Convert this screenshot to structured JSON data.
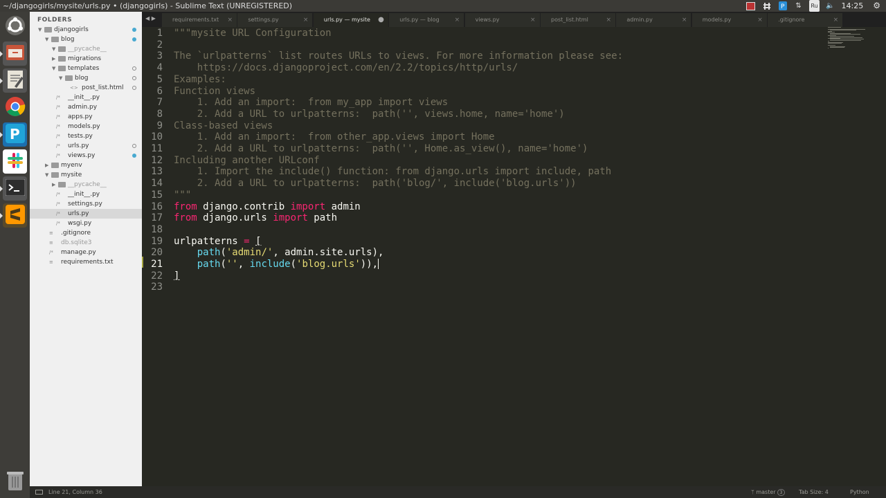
{
  "window": {
    "title": "~/djangogirls/mysite/urls.py • (djangogirls) - Sublime Text (UNREGISTERED)",
    "clock": "14:25",
    "keyboard_layout": "Ru"
  },
  "launcher": {
    "items": [
      {
        "name": "ubuntu-dash-icon",
        "color": "#e06b2b"
      },
      {
        "name": "files-icon",
        "color": "#c8553a"
      },
      {
        "name": "text-editor-icon",
        "color": "#d9d4c5"
      },
      {
        "name": "chrome-icon",
        "color": "#4285f4"
      },
      {
        "name": "pycharm-icon",
        "color": "#21a4d8"
      },
      {
        "name": "slack-icon",
        "color": "#ffffff"
      },
      {
        "name": "terminal-icon",
        "color": "#2d2d2d"
      },
      {
        "name": "sublime-text-icon",
        "color": "#ff9800"
      },
      {
        "name": "trash-icon",
        "color": "#8a8a8a"
      }
    ]
  },
  "sidebar": {
    "header": "FOLDERS",
    "items": [
      {
        "label": "djangogirls",
        "type": "folder",
        "depth": 0,
        "open": true,
        "dim": false,
        "status": "filled"
      },
      {
        "label": "blog",
        "type": "folder",
        "depth": 1,
        "open": true,
        "dim": false,
        "status": "filled"
      },
      {
        "label": "__pycache__",
        "type": "folder",
        "depth": 2,
        "open": true,
        "dim": true,
        "status": ""
      },
      {
        "label": "migrations",
        "type": "folder",
        "depth": 2,
        "open": false,
        "dim": false,
        "status": ""
      },
      {
        "label": "templates",
        "type": "folder",
        "depth": 2,
        "open": true,
        "dim": false,
        "status": "ring"
      },
      {
        "label": "blog",
        "type": "folder",
        "depth": 3,
        "open": true,
        "dim": false,
        "status": "ring"
      },
      {
        "label": "post_list.html",
        "type": "html",
        "depth": 4,
        "dim": false,
        "status": "ring"
      },
      {
        "label": "__init__.py",
        "type": "py",
        "depth": 2,
        "dim": false,
        "status": ""
      },
      {
        "label": "admin.py",
        "type": "py",
        "depth": 2,
        "dim": false,
        "status": ""
      },
      {
        "label": "apps.py",
        "type": "py",
        "depth": 2,
        "dim": false,
        "status": ""
      },
      {
        "label": "models.py",
        "type": "py",
        "depth": 2,
        "dim": false,
        "status": ""
      },
      {
        "label": "tests.py",
        "type": "py",
        "depth": 2,
        "dim": false,
        "status": ""
      },
      {
        "label": "urls.py",
        "type": "py",
        "depth": 2,
        "dim": false,
        "status": "ring"
      },
      {
        "label": "views.py",
        "type": "py",
        "depth": 2,
        "dim": false,
        "status": "filled"
      },
      {
        "label": "myenv",
        "type": "folder",
        "depth": 1,
        "open": false,
        "dim": false,
        "status": ""
      },
      {
        "label": "mysite",
        "type": "folder",
        "depth": 1,
        "open": true,
        "dim": false,
        "status": ""
      },
      {
        "label": "__pycache__",
        "type": "folder",
        "depth": 2,
        "open": false,
        "dim": true,
        "status": ""
      },
      {
        "label": "__init__.py",
        "type": "py",
        "depth": 2,
        "dim": false,
        "status": ""
      },
      {
        "label": "settings.py",
        "type": "py",
        "depth": 2,
        "dim": false,
        "status": ""
      },
      {
        "label": "urls.py",
        "type": "py",
        "depth": 2,
        "dim": false,
        "status": "",
        "selected": true
      },
      {
        "label": "wsgi.py",
        "type": "py",
        "depth": 2,
        "dim": false,
        "status": ""
      },
      {
        "label": ".gitignore",
        "type": "file",
        "depth": 1,
        "dim": false,
        "status": ""
      },
      {
        "label": "db.sqlite3",
        "type": "file",
        "depth": 1,
        "dim": true,
        "status": ""
      },
      {
        "label": "manage.py",
        "type": "py",
        "depth": 1,
        "dim": false,
        "status": ""
      },
      {
        "label": "requirements.txt",
        "type": "file",
        "depth": 1,
        "dim": false,
        "status": ""
      }
    ]
  },
  "tabs": [
    {
      "label": "requirements.txt",
      "active": false,
      "modified": false
    },
    {
      "label": "settings.py",
      "active": false,
      "modified": false
    },
    {
      "label": "urls.py — mysite",
      "active": true,
      "modified": true
    },
    {
      "label": "urls.py — blog",
      "active": false,
      "modified": false
    },
    {
      "label": "views.py",
      "active": false,
      "modified": false
    },
    {
      "label": "post_list.html",
      "active": false,
      "modified": false
    },
    {
      "label": "admin.py",
      "active": false,
      "modified": false
    },
    {
      "label": "models.py",
      "active": false,
      "modified": false
    },
    {
      "label": ".gitignore",
      "active": false,
      "modified": false
    }
  ],
  "editor": {
    "current_line": 21,
    "lines": [
      [
        [
          "cm",
          "\"\"\"mysite URL Configuration"
        ]
      ],
      [],
      [
        [
          "cm",
          "The `urlpatterns` list routes URLs to views. For more information please see:"
        ]
      ],
      [
        [
          "cm",
          "    https://docs.djangoproject.com/en/2.2/topics/http/urls/"
        ]
      ],
      [
        [
          "cm",
          "Examples:"
        ]
      ],
      [
        [
          "cm",
          "Function views"
        ]
      ],
      [
        [
          "cm",
          "    1. Add an import:  from my_app import views"
        ]
      ],
      [
        [
          "cm",
          "    2. Add a URL to urlpatterns:  path('', views.home, name='home')"
        ]
      ],
      [
        [
          "cm",
          "Class-based views"
        ]
      ],
      [
        [
          "cm",
          "    1. Add an import:  from other_app.views import Home"
        ]
      ],
      [
        [
          "cm",
          "    2. Add a URL to urlpatterns:  path('', Home.as_view(), name='home')"
        ]
      ],
      [
        [
          "cm",
          "Including another URLconf"
        ]
      ],
      [
        [
          "cm",
          "    1. Import the include() function: from django.urls import include, path"
        ]
      ],
      [
        [
          "cm",
          "    2. Add a URL to urlpatterns:  path('blog/', include('blog.urls'))"
        ]
      ],
      [
        [
          "cm",
          "\"\"\""
        ]
      ],
      [
        [
          "kw",
          "from"
        ],
        [
          "",
          " django.contrib "
        ],
        [
          "kw",
          "import"
        ],
        [
          "",
          " admin"
        ]
      ],
      [
        [
          "kw",
          "from"
        ],
        [
          "",
          " django.urls "
        ],
        [
          "kw",
          "import"
        ],
        [
          "",
          " path"
        ]
      ],
      [],
      [
        [
          "",
          "urlpatterns "
        ],
        [
          "kw",
          "="
        ],
        [
          "",
          " "
        ],
        [
          "bracket",
          "["
        ]
      ],
      [
        [
          "",
          "    "
        ],
        [
          "fn",
          "path"
        ],
        [
          "",
          "("
        ],
        [
          "st",
          "'admin/'"
        ],
        [
          "",
          ", admin.site.urls),"
        ]
      ],
      [
        [
          "",
          "    "
        ],
        [
          "fn",
          "path"
        ],
        [
          "",
          "("
        ],
        [
          "st",
          "''"
        ],
        [
          "",
          ", "
        ],
        [
          "fn",
          "include"
        ],
        [
          "",
          "("
        ],
        [
          "st",
          "'blog.urls'"
        ],
        [
          "",
          ")),"
        ],
        [
          "cursor",
          ""
        ]
      ],
      [
        [
          "bracket",
          "]"
        ]
      ],
      []
    ]
  },
  "status": {
    "position": "Line 21, Column 36",
    "branch": "master",
    "branch_count": "3",
    "tab_size": "Tab Size: 4",
    "syntax": "Python"
  }
}
